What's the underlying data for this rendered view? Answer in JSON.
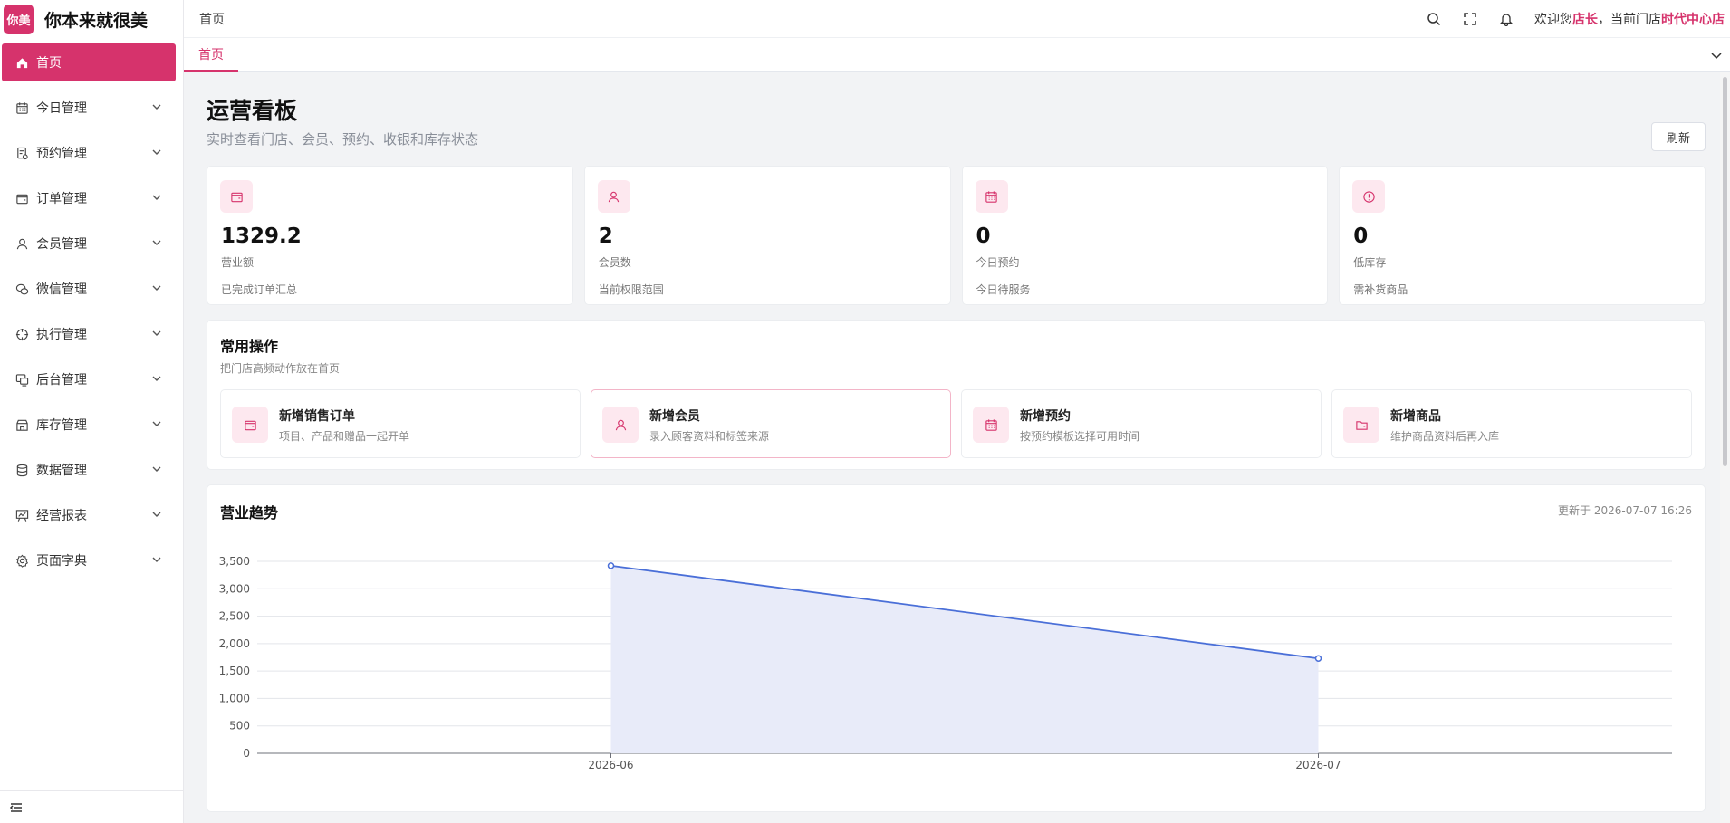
{
  "brand": {
    "logo_text": "你美",
    "name": "你本来就很美"
  },
  "sidebar": {
    "items": [
      {
        "label": "首页",
        "icon": "home-icon",
        "active": true
      },
      {
        "label": "今日管理",
        "icon": "calendar-icon"
      },
      {
        "label": "预约管理",
        "icon": "booking-icon"
      },
      {
        "label": "订单管理",
        "icon": "wallet-icon"
      },
      {
        "label": "会员管理",
        "icon": "user-icon"
      },
      {
        "label": "微信管理",
        "icon": "wechat-icon"
      },
      {
        "label": "执行管理",
        "icon": "target-icon"
      },
      {
        "label": "后台管理",
        "icon": "monitor-icon"
      },
      {
        "label": "库存管理",
        "icon": "store-icon"
      },
      {
        "label": "数据管理",
        "icon": "database-icon"
      },
      {
        "label": "经营报表",
        "icon": "report-icon"
      },
      {
        "label": "页面字典",
        "icon": "settings-icon"
      }
    ]
  },
  "header": {
    "breadcrumb": "首页",
    "welcome_prefix": "欢迎您",
    "user_role": "店长",
    "welcome_mid": "，当前门店",
    "store_name": "时代中心店"
  },
  "tabs": [
    {
      "label": "首页"
    }
  ],
  "main": {
    "title": "运营看板",
    "subtitle": "实时查看门店、会员、预约、收银和库存状态",
    "refresh_label": "刷新",
    "stats": [
      {
        "value": "1329.2",
        "label": "营业额",
        "desc": "已完成订单汇总",
        "icon": "wallet-icon"
      },
      {
        "value": "2",
        "label": "会员数",
        "desc": "当前权限范围",
        "icon": "user-icon"
      },
      {
        "value": "0",
        "label": "今日预约",
        "desc": "今日待服务",
        "icon": "calendar-icon"
      },
      {
        "value": "0",
        "label": "低库存",
        "desc": "需补货商品",
        "icon": "alert-icon"
      }
    ],
    "ops": {
      "title": "常用操作",
      "subtitle": "把门店高频动作放在首页",
      "items": [
        {
          "name": "新增销售订单",
          "desc": "项目、产品和赠品一起开单",
          "icon": "wallet-icon"
        },
        {
          "name": "新增会员",
          "desc": "录入顾客资料和标签来源",
          "icon": "user-icon"
        },
        {
          "name": "新增预约",
          "desc": "按预约模板选择可用时间",
          "icon": "calendar-icon"
        },
        {
          "name": "新增商品",
          "desc": "维护商品资料后再入库",
          "icon": "folder-icon"
        }
      ]
    },
    "trend": {
      "title": "营业趋势",
      "updated": "更新于 2026-07-07 16:26"
    }
  },
  "colors": {
    "accent": "#d6336c",
    "line": "#4a6fd8",
    "area": "#e8ebf9"
  },
  "chart_data": {
    "type": "area",
    "categories": [
      "2026-06",
      "2026-07"
    ],
    "series": [
      {
        "values": [
          3420,
          1730
        ]
      }
    ],
    "ylim": [
      0,
      3500
    ],
    "yticks": [
      "0",
      "500",
      "1,000",
      "1,500",
      "2,000",
      "2,500",
      "3,000",
      "3,500"
    ],
    "grid": true,
    "legend": "none"
  }
}
